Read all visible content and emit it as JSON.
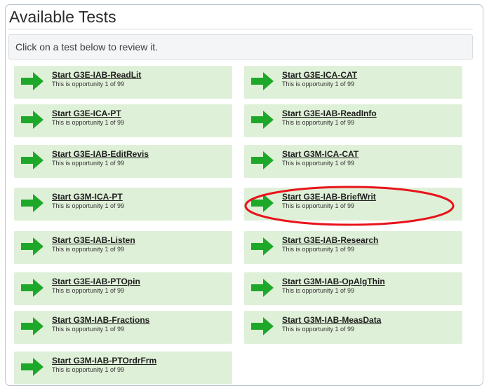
{
  "page": {
    "title": "Available Tests",
    "instructions": "Click on a test below to review it."
  },
  "colors": {
    "card_bg": "#dff0d8",
    "arrow": "#1ea82a",
    "highlight": "#e8141b"
  },
  "highlighted_test": "Start G3E-IAB-BriefWrit",
  "tests": [
    {
      "label": "Start G3E-IAB-ReadLit",
      "opportunity": "This is opportunity 1 of 99"
    },
    {
      "label": "Start G3E-ICA-CAT",
      "opportunity": "This is opportunity 1 of 99"
    },
    {
      "label": "Start G3E-ICA-PT",
      "opportunity": "This is opportunity 1 of 99"
    },
    {
      "label": "Start G3E-IAB-ReadInfo",
      "opportunity": "This is opportunity 1 of 99"
    },
    {
      "label": "Start G3E-IAB-EditRevis",
      "opportunity": "This is opportunity 1 of 99"
    },
    {
      "label": "Start G3M-ICA-CAT",
      "opportunity": "This is opportunity 1 of 99"
    },
    {
      "label": "Start G3M-ICA-PT",
      "opportunity": "This is opportunity 1 of 99"
    },
    {
      "label": "Start G3E-IAB-BriefWrit",
      "opportunity": "This is opportunity 1 of 99"
    },
    {
      "label": "Start G3E-IAB-Listen",
      "opportunity": "This is opportunity 1 of 99"
    },
    {
      "label": "Start G3E-IAB-Research",
      "opportunity": "This is opportunity 1 of 99"
    },
    {
      "label": "Start G3E-IAB-PTOpin",
      "opportunity": "This is opportunity 1 of 99"
    },
    {
      "label": "Start G3M-IAB-OpAlgThin",
      "opportunity": "This is opportunity 1 of 99"
    },
    {
      "label": "Start G3M-IAB-Fractions",
      "opportunity": "This is opportunity 1 of 99"
    },
    {
      "label": "Start G3M-IAB-MeasData",
      "opportunity": "This is opportunity 1 of 99"
    },
    {
      "label": "Start G3M-IAB-PTOrdrFrm",
      "opportunity": "This is opportunity 1 of 99"
    }
  ]
}
